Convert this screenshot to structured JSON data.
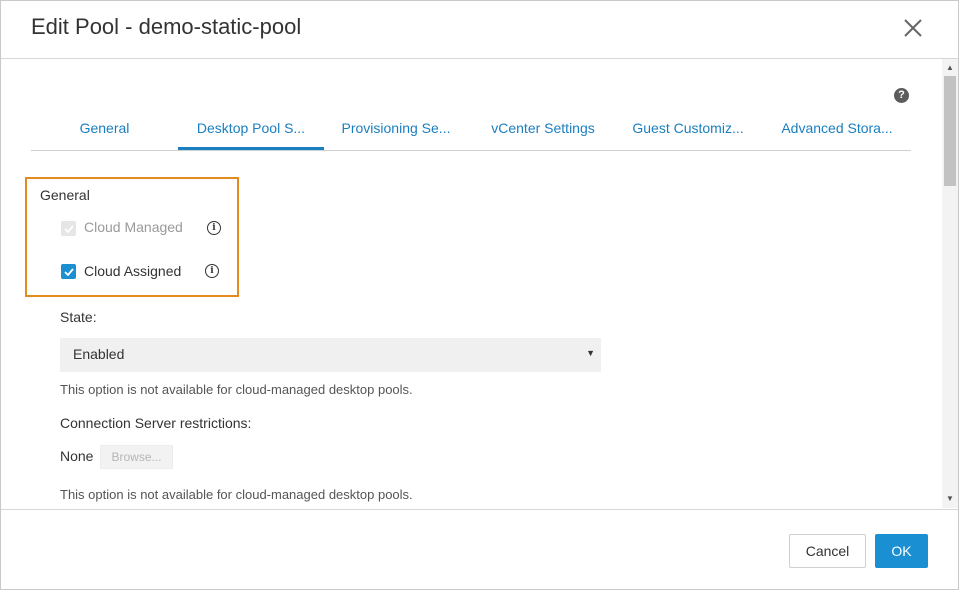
{
  "dialog": {
    "title": "Edit Pool - demo-static-pool",
    "close_icon": "close-icon",
    "help_icon": "?"
  },
  "tabs": [
    {
      "label": "General",
      "active": false
    },
    {
      "label": "Desktop Pool S...",
      "active": true
    },
    {
      "label": "Provisioning Se...",
      "active": false
    },
    {
      "label": "vCenter Settings",
      "active": false
    },
    {
      "label": "Guest Customiz...",
      "active": false
    },
    {
      "label": "Advanced Stora...",
      "active": false
    }
  ],
  "general_section": {
    "label": "General",
    "cloud_managed": {
      "label": "Cloud Managed",
      "checked": true,
      "disabled": true
    },
    "cloud_assigned": {
      "label": "Cloud Assigned",
      "checked": true,
      "disabled": false
    },
    "info_icon": "i"
  },
  "state": {
    "label": "State:",
    "value": "Enabled",
    "hint": "This option is not available for cloud-managed desktop pools."
  },
  "connection_server": {
    "label": "Connection Server restrictions:",
    "value": "None",
    "browse_label": "Browse...",
    "hint": "This option is not available for cloud-managed desktop pools."
  },
  "footer": {
    "cancel_label": "Cancel",
    "ok_label": "OK"
  },
  "colors": {
    "accent": "#1a8fd1",
    "highlight": "#e58a1f"
  }
}
